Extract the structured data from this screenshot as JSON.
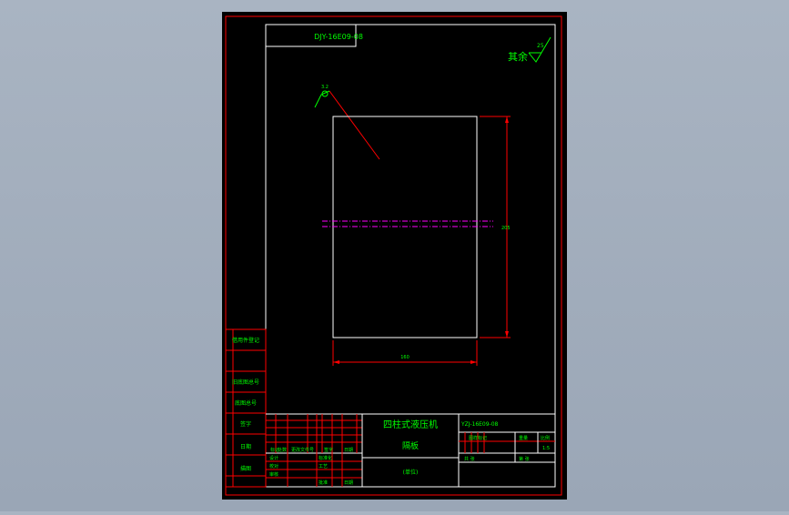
{
  "drawing": {
    "top_tag": "DJY-16E09-08",
    "roughness_text": "其余",
    "roughness_value": "25",
    "surface_note": "3.2",
    "dim_width": "160",
    "dim_height": "205",
    "title_machine": "四柱式液压机",
    "title_part": "隔板",
    "title_company": "(单位)",
    "drawing_code": "YZJ-16E09-08",
    "material_label": "图样标记",
    "weight_label": "重量",
    "scale_label": "比例",
    "scale_value": "1:5",
    "sheet_total_label": "共  张",
    "sheet_label": "第  张"
  },
  "side_labels": [
    "借用件登记",
    "旧底图总号",
    "底图总号",
    "签字",
    "日期",
    "描图"
  ],
  "revision_labels": [
    "标记",
    "处数",
    "更改文件号",
    "签字",
    "日期"
  ],
  "sign_labels": [
    "设计",
    "校对",
    "审核",
    "标准化",
    "工艺",
    "批准",
    "日期"
  ],
  "colors": {
    "background": "#000000",
    "frame": "#ff0000",
    "geometry": "#ffffff",
    "text": "#00ff00",
    "centerline": "#ff00ff",
    "leader": "#ff0000"
  }
}
